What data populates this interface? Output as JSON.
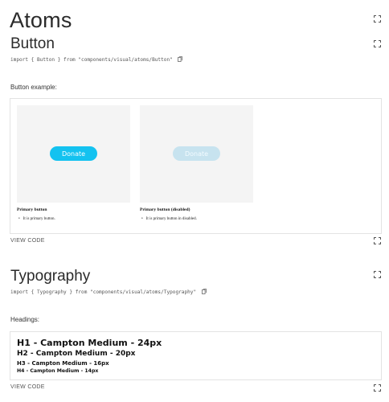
{
  "page": {
    "title": "Atoms"
  },
  "button_section": {
    "title": "Button",
    "import_line": "import { Button } from \"components/visual/atoms/Button\"",
    "example_label": "Button example:",
    "cards": [
      {
        "button_label": "Donate",
        "name": "Primary button",
        "description": "It is primary button."
      },
      {
        "button_label": "Donate",
        "name": "Primary button (disabled)",
        "description": "It is primary button in disabled."
      }
    ],
    "view_code": "VIEW CODE"
  },
  "typography_section": {
    "title": "Typography",
    "import_line": "import { Typography } from \"components/visual/atoms/Typography\"",
    "example_label": "Headings:",
    "headings": [
      "H1 - Campton Medium - 24px",
      "H2 - Campton Medium - 20px",
      "H3 - Campton Medium - 16px",
      "H4 - Campton Medium - 14px"
    ],
    "view_code": "VIEW CODE"
  },
  "colors": {
    "primary_button": "#14c2f0",
    "disabled_button": "#c7e3ef",
    "preview_bg": "#f4f4f4",
    "border": "#e3e3e3"
  },
  "icons": {
    "expand": "expand-icon",
    "copy": "copy-icon"
  }
}
